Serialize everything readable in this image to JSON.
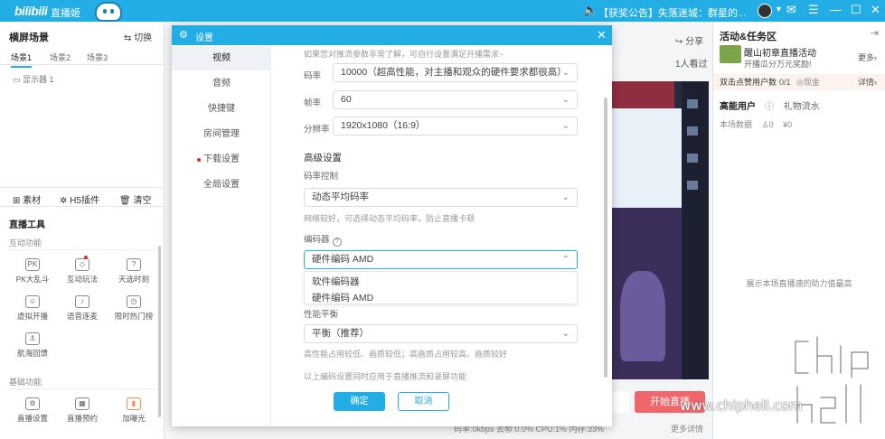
{
  "titlebar": {
    "logo": "bilibili",
    "app_name": "直播姬",
    "announcement": "【获奖公告】失落迷城：群星的...",
    "icons": [
      "user-avatar-icon",
      "chevron-down-icon",
      "mail-icon",
      "menu-icon",
      "minimize-icon",
      "maximize-icon",
      "close-icon"
    ]
  },
  "left_panel": {
    "title": "横屏场景",
    "switch_label": "切换",
    "scene_tabs": [
      "场景1",
      "场景2",
      "场景3"
    ],
    "display_item": "显示器 1",
    "tools": {
      "material": "素材",
      "h5": "H5插件",
      "clear": "清空"
    },
    "live_tools_title": "直播工具",
    "interactive_title": "互动功能",
    "interactive_items": [
      "PK大乱斗",
      "互动玩法",
      "天选时刻",
      "虚拟开播",
      "语音连麦",
      "限时热门榜",
      "航海回馈"
    ],
    "basic_title": "基础功能",
    "basic_items": [
      "直播设置",
      "直播预约",
      "加曝光"
    ]
  },
  "center": {
    "share": "分享",
    "watch": "1人看过",
    "start_button": "开始直播",
    "status": "码率:0kbps    丢帧:0.0%    CPU:1%    内存:33%",
    "more_status": "更多详情"
  },
  "right_panel": {
    "title": "活动&任务区",
    "activity_name": "醒山初章直播活动",
    "activity_sub": "开播瓜分万元奖励!",
    "more": "更多",
    "task_label": "双击点赞用户数",
    "task_progress": "0/1",
    "task_reward": "现金",
    "task_detail": "详情",
    "tab_high_energy": "高能用户",
    "tab_gifts": "礼物流水",
    "stat_label": "本场数据",
    "stat_count": "0",
    "stat_money": "¥0",
    "empty_text": "展示本场直播速的助力值最高"
  },
  "watermark": "www.chiphell.com",
  "settings_modal": {
    "title": "设置",
    "nav": [
      "视频",
      "音频",
      "快捷键",
      "房间管理",
      "下载设置",
      "全局设置"
    ],
    "active_nav": "视频",
    "note": "如果您对推流参数非常了解，可自行设置满足开播需求~",
    "bitrate_label": "码率",
    "bitrate_value": "10000（超高性能，对主播和观众的硬件要求都很高）",
    "fps_label": "帧率",
    "fps_value": "60",
    "resolution_label": "分辨率",
    "resolution_value": "1920x1080（16:9）",
    "advanced_title": "高级设置",
    "rate_control_label": "码率控制",
    "rate_control_value": "动态平均码率",
    "rate_control_hint": "网络较好，可选择动态平均码率，防止直播卡顿",
    "encoder_label": "编码器",
    "encoder_value": "硬件编码 AMD",
    "encoder_options": [
      "软件编码器",
      "硬件编码 AMD"
    ],
    "balance_label": "性能平衡",
    "balance_value": "平衡（推荐）",
    "balance_hint": "高性能占用较低、画质较低；高画质占用较高、画质较好",
    "apply_hint": "以上编码设置同时应用于直播推流和录屏功能",
    "ok_button": "确定",
    "cancel_button": "取消"
  },
  "colors": {
    "accent": "#23ade5",
    "start": "#f0666a"
  }
}
